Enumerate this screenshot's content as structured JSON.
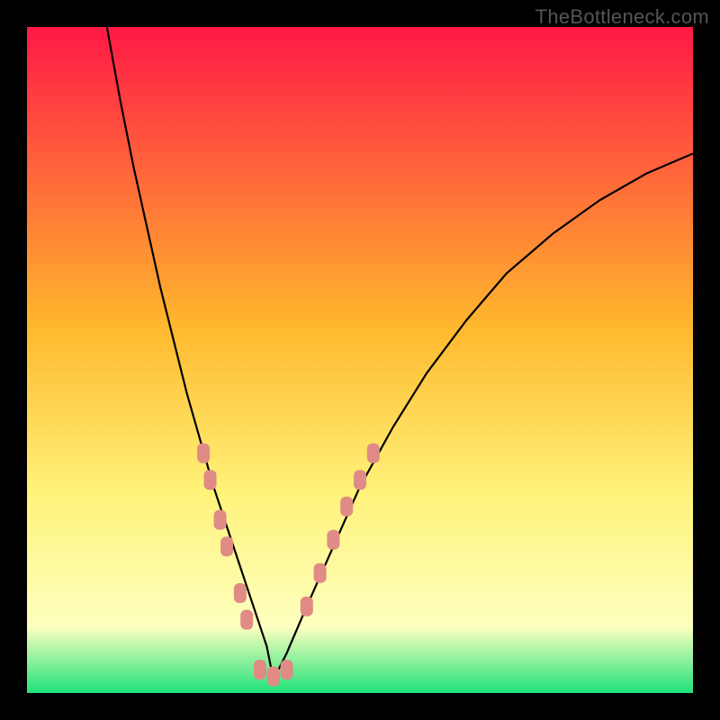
{
  "watermark": "TheBottleneck.com",
  "colors": {
    "background": "#000000",
    "curve": "#000000",
    "markers": "#e08b85",
    "gradient_top": "#ff1846",
    "gradient_mid1": "#ffb82d",
    "gradient_mid2": "#fff37a",
    "gradient_mid3": "#fdffbf",
    "gradient_bottom": "#1fe27a"
  },
  "chart_data": {
    "type": "line",
    "title": "",
    "xlabel": "",
    "ylabel": "",
    "xlim": [
      0,
      100
    ],
    "ylim": [
      0,
      100
    ],
    "curve": {
      "left_branch_x": [
        12,
        14,
        16,
        18,
        20,
        22,
        24,
        26,
        28,
        30,
        32,
        34,
        36,
        37
      ],
      "left_branch_y": [
        100,
        89,
        79,
        70,
        61,
        53,
        45,
        38,
        31,
        25,
        19,
        13,
        7,
        2
      ],
      "right_branch_x": [
        37,
        39,
        42,
        46,
        50,
        55,
        60,
        66,
        72,
        79,
        86,
        93,
        100
      ],
      "right_branch_y": [
        2,
        6,
        13,
        22,
        31,
        40,
        48,
        56,
        63,
        69,
        74,
        78,
        81
      ]
    },
    "markers": {
      "left_cluster": [
        {
          "x": 26.5,
          "y": 36
        },
        {
          "x": 27.5,
          "y": 32
        },
        {
          "x": 29,
          "y": 26
        },
        {
          "x": 30,
          "y": 22
        },
        {
          "x": 32,
          "y": 15
        },
        {
          "x": 33,
          "y": 11
        }
      ],
      "right_cluster": [
        {
          "x": 42,
          "y": 13
        },
        {
          "x": 44,
          "y": 18
        },
        {
          "x": 46,
          "y": 23
        },
        {
          "x": 48,
          "y": 28
        },
        {
          "x": 50,
          "y": 32
        },
        {
          "x": 52,
          "y": 36
        }
      ],
      "bottom_cluster": [
        {
          "x": 35,
          "y": 3.5
        },
        {
          "x": 37,
          "y": 2.5
        },
        {
          "x": 39,
          "y": 3.5
        }
      ]
    }
  }
}
